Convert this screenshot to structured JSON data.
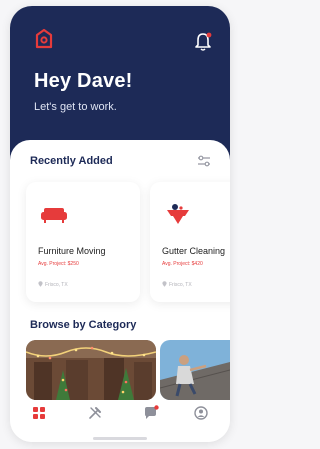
{
  "header": {
    "greeting": "Hey Dave!",
    "subtitle": "Let's get to work."
  },
  "recently_added": {
    "title": "Recently Added",
    "items": [
      {
        "name": "Furniture Moving",
        "price": "Avg. Project: $250",
        "location": "Frisco, TX",
        "icon": "sofa-icon"
      },
      {
        "name": "Gutter Cleaning",
        "price": "Avg. Project: $420",
        "location": "Frisco, TX",
        "icon": "gutter-cleaning-icon"
      }
    ]
  },
  "browse": {
    "title": "Browse by Category",
    "categories": [
      "holiday-decor-image",
      "roofing-image"
    ]
  },
  "tabs": [
    "home-icon",
    "tools-icon",
    "messages-icon",
    "profile-icon"
  ],
  "colors": {
    "navy": "#1d2a57",
    "accent": "#e63b3b"
  }
}
